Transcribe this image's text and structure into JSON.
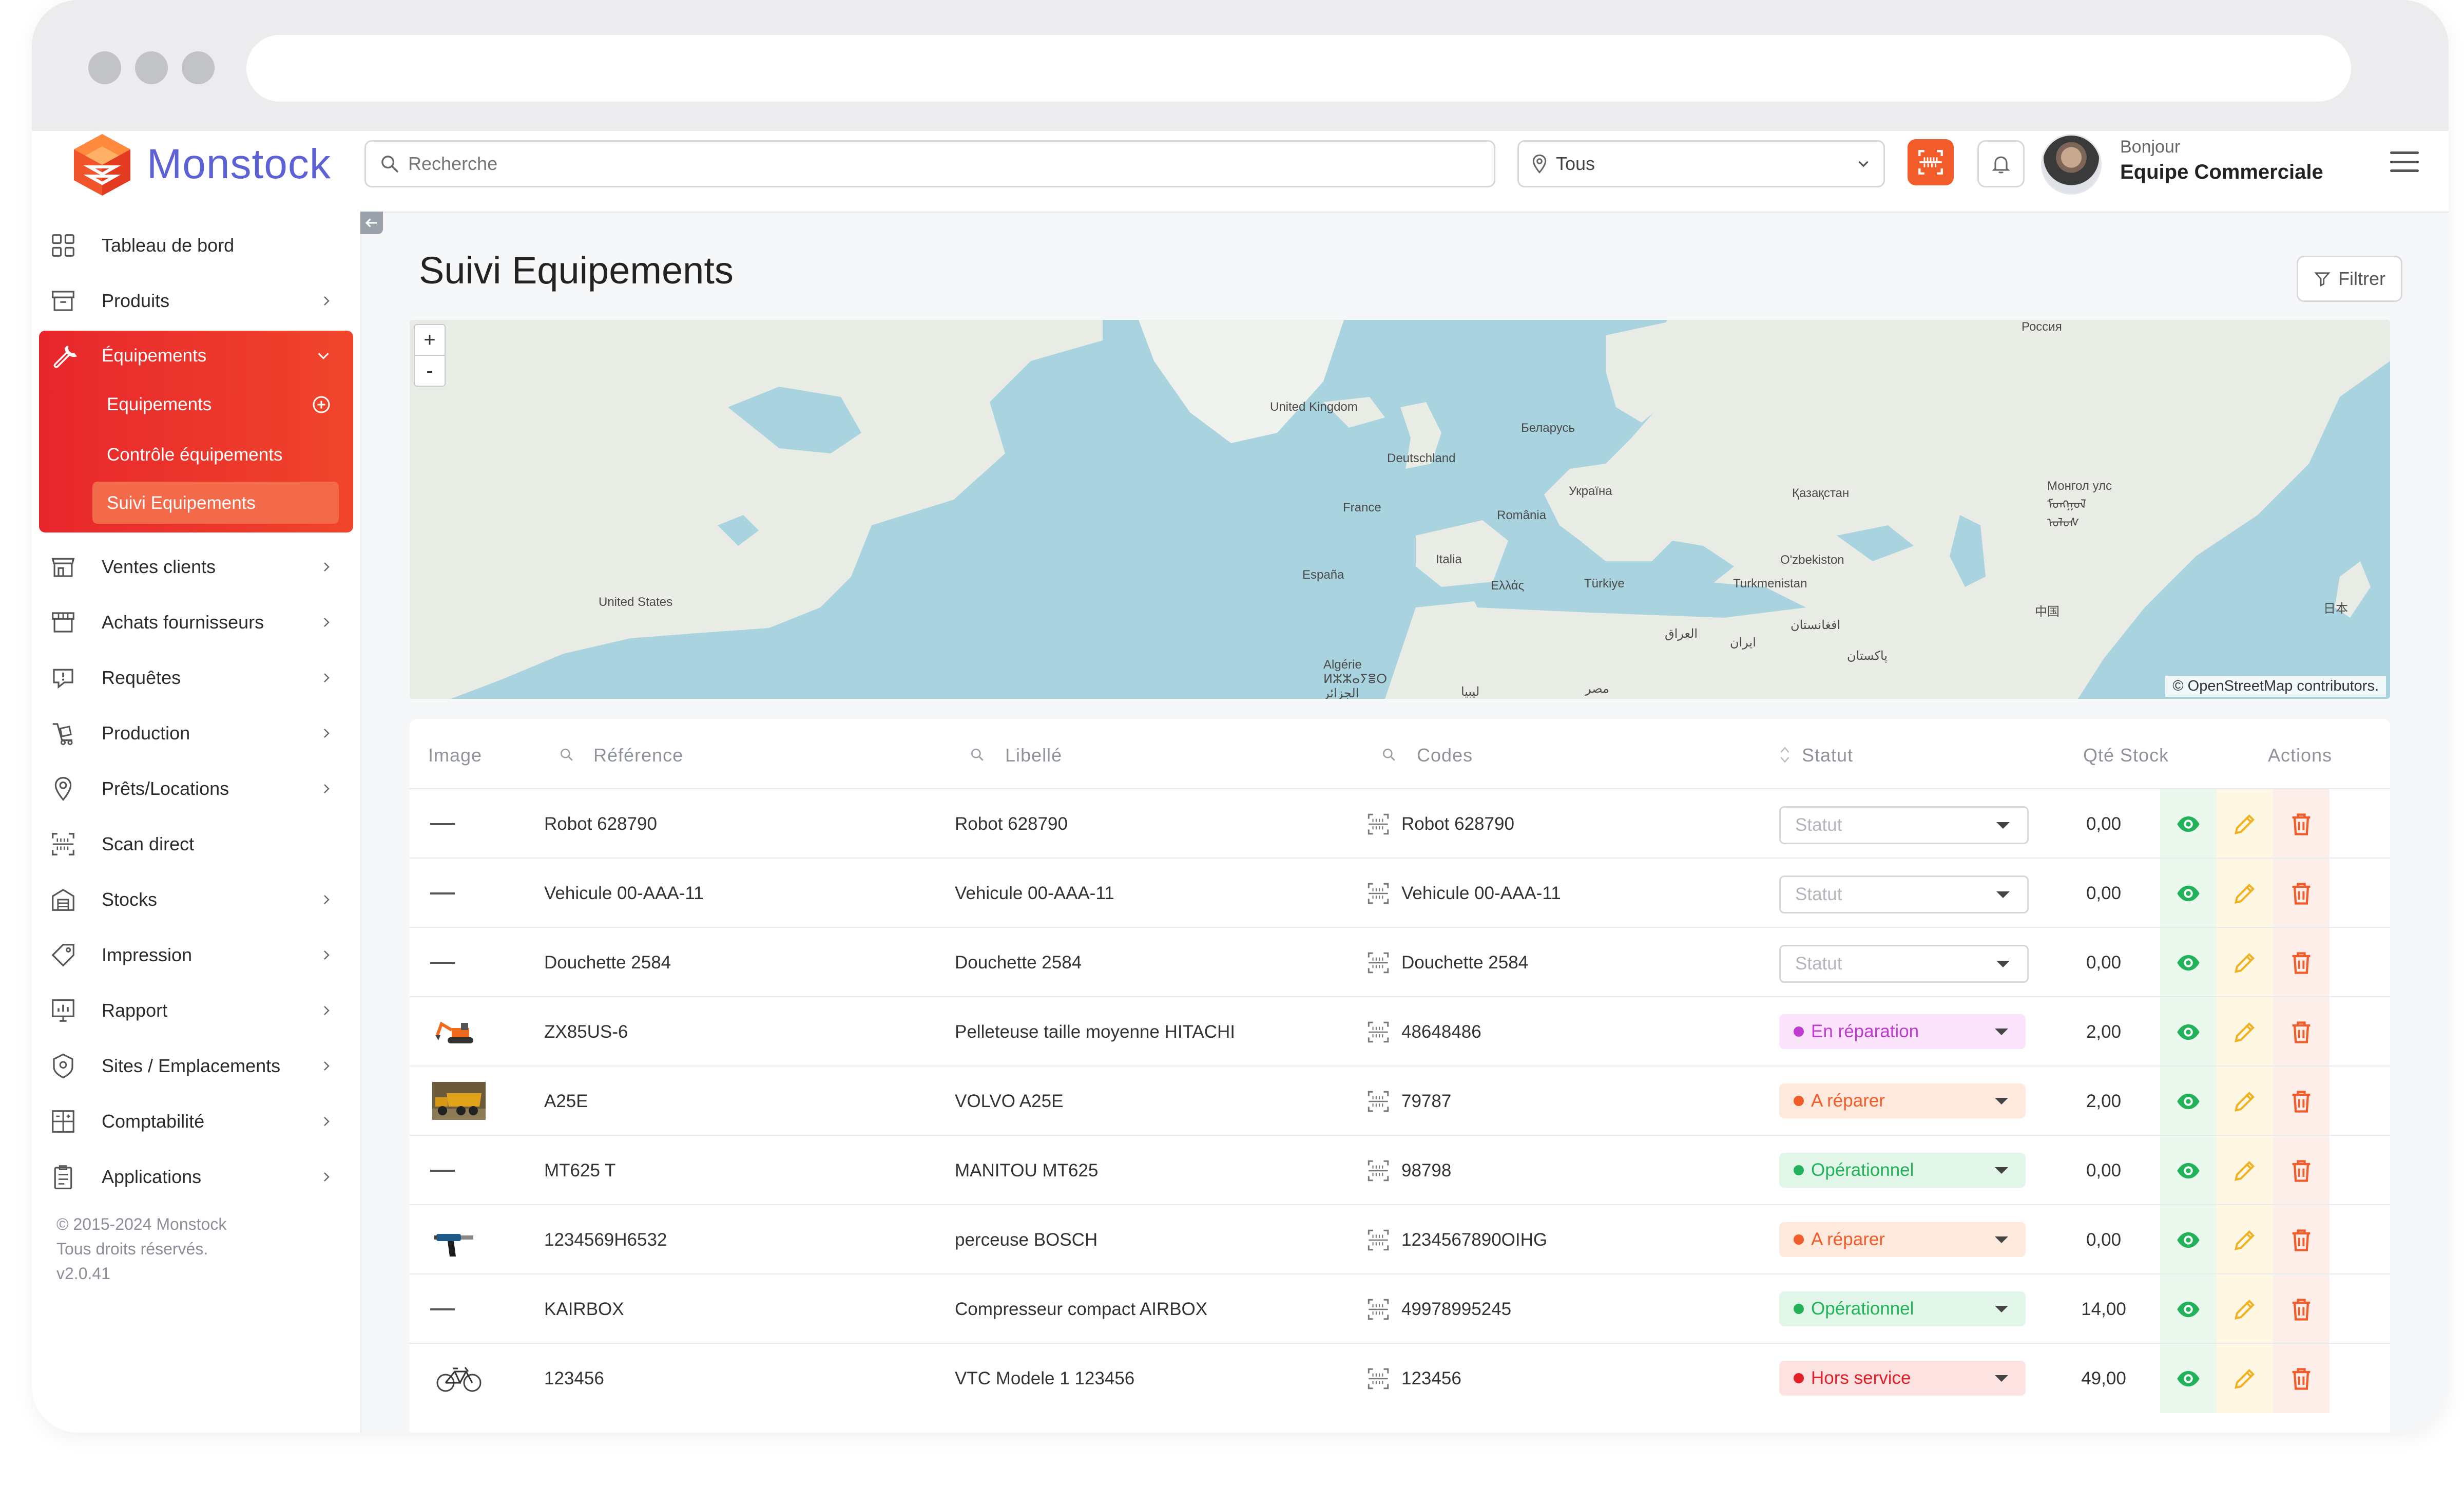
{
  "app": {
    "name": "Monstock",
    "brand_color": "#5c61d6",
    "accent_color": "#f0452b"
  },
  "search": {
    "placeholder": "Recherche"
  },
  "location_filter": {
    "value": "Tous"
  },
  "user": {
    "greeting": "Bonjour",
    "name": "Equipe Commerciale"
  },
  "sidebar": {
    "items": [
      {
        "label": "Tableau de bord",
        "icon": "dashboard-icon"
      },
      {
        "label": "Produits",
        "icon": "box-icon"
      },
      {
        "label": "Équipements",
        "icon": "wrench-icon",
        "expanded": true,
        "children": [
          {
            "label": "Equipements"
          },
          {
            "label": "Contrôle équipements"
          },
          {
            "label": "Suivi Equipements",
            "active": true
          }
        ]
      },
      {
        "label": "Ventes clients",
        "icon": "store-icon"
      },
      {
        "label": "Achats fournisseurs",
        "icon": "shop-icon"
      },
      {
        "label": "Requêtes",
        "icon": "alert-bubble-icon"
      },
      {
        "label": "Production",
        "icon": "production-icon"
      },
      {
        "label": "Prêts/Locations",
        "icon": "pin-icon"
      },
      {
        "label": "Scan direct",
        "icon": "scan-icon"
      },
      {
        "label": "Stocks",
        "icon": "warehouse-icon"
      },
      {
        "label": "Impression",
        "icon": "tag-icon"
      },
      {
        "label": "Rapport",
        "icon": "report-icon"
      },
      {
        "label": "Sites / Emplacements",
        "icon": "site-pin-icon"
      },
      {
        "label": "Comptabilité",
        "icon": "accounting-icon"
      },
      {
        "label": "Applications",
        "icon": "clipboard-icon"
      }
    ],
    "copyright": [
      "© 2015-2024 Monstock",
      "Tous droits réservés.",
      "v2.0.41"
    ]
  },
  "page": {
    "title": "Suivi Equipements",
    "filter_label": "Filtrer"
  },
  "map": {
    "zoom_in": "+",
    "zoom_out": "-",
    "credit": "© OpenStreetMap contributors.",
    "labels": [
      "Россия",
      "United Kingdom",
      "Беларусь",
      "Deutschland",
      "Україна",
      "France",
      "România",
      "Қазақстан",
      "Монгол улс ᠮᠣᠩᠭᠣᠯ ᠤᠯᠤᠰ",
      "España",
      "Italia",
      "O'zbekiston",
      "Ελλάς",
      "Türkiye",
      "Turkmenistan",
      "United States",
      "中国",
      "日本",
      "العراق",
      "ایران",
      "افغانستان",
      "پاکستان",
      "Algérie ⵍⵣⵣⴰⵢⴻⵔ الجزائر",
      "ليبيا",
      "مصر"
    ]
  },
  "table": {
    "headers": {
      "image": "Image",
      "reference": "Référence",
      "libelle": "Libellé",
      "codes": "Codes",
      "statut": "Statut",
      "qte": "Qté Stock",
      "actions": "Actions"
    },
    "status_placeholder": "Statut",
    "rows": [
      {
        "reference": "Robot 628790",
        "libelle": "Robot 628790",
        "code": "Robot 628790",
        "status": "",
        "qty": "0,00",
        "image": "none"
      },
      {
        "reference": "Vehicule 00-AAA-11",
        "libelle": "Vehicule 00-AAA-11",
        "code": "Vehicule 00-AAA-11",
        "status": "",
        "qty": "0,00",
        "image": "none"
      },
      {
        "reference": "Douchette 2584",
        "libelle": "Douchette 2584",
        "code": "Douchette 2584",
        "status": "",
        "qty": "0,00",
        "image": "none"
      },
      {
        "reference": "ZX85US-6",
        "libelle": "Pelleteuse taille moyenne HITACHI",
        "code": "48648486",
        "status": "En réparation",
        "status_color": "#c03bd0",
        "status_bg": "#fbe3fb",
        "qty": "2,00",
        "image": "excavator"
      },
      {
        "reference": "A25E",
        "libelle": "VOLVO A25E",
        "code": "79787",
        "status": "A réparer",
        "status_color": "#f25b2a",
        "status_bg": "#ffe9dc",
        "qty": "2,00",
        "image": "dumper"
      },
      {
        "reference": "MT625 T",
        "libelle": "MANITOU MT625",
        "code": "98798",
        "status": "Opérationnel",
        "status_color": "#22b35a",
        "status_bg": "#e1f6e8",
        "qty": "0,00",
        "image": "none"
      },
      {
        "reference": "1234569H6532",
        "libelle": "perceuse BOSCH",
        "code": "1234567890OIHG",
        "status": "A réparer",
        "status_color": "#f25b2a",
        "status_bg": "#ffe9dc",
        "qty": "0,00",
        "image": "drill"
      },
      {
        "reference": "KAIRBOX",
        "libelle": "Compresseur compact AIRBOX",
        "code": "49978995245",
        "status": "Opérationnel",
        "status_color": "#22b35a",
        "status_bg": "#e1f6e8",
        "qty": "14,00",
        "image": "none"
      },
      {
        "reference": "123456",
        "libelle": "VTC Modele 1 123456",
        "code": "123456",
        "status": "Hors service",
        "status_color": "#e3202a",
        "status_bg": "#fde2e2",
        "qty": "49,00",
        "image": "bike"
      }
    ]
  }
}
